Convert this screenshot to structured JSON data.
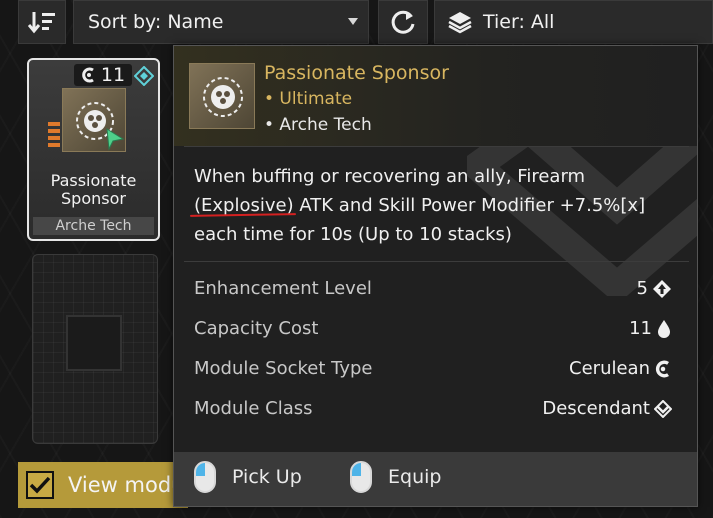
{
  "toolbar": {
    "sort_order_icon": "sort-descending-icon",
    "sort_label": "Sort by: Name",
    "refresh_icon": "refresh-icon",
    "tier_icon": "layers-icon",
    "tier_label": "Tier: All"
  },
  "module_card": {
    "capacity": "11",
    "capacity_icon": "cerulean-socket-icon",
    "name": "Passionate Sponsor",
    "brand": "Arche Tech",
    "tier_color": "#e07a2c"
  },
  "view_toggle": {
    "label": "View modu",
    "checked": true
  },
  "tooltip": {
    "title": "Passionate Sponsor",
    "tier": "• Ultimate",
    "brand": "• Arche Tech",
    "description_pre": "When buffing or recovering an ally, Firearm ",
    "description_highlight": "(Explosive)",
    "description_post": " ATK and Skill Power Modifier +7.5%[x] each time for 10s (Up to 10 stacks)",
    "stats": [
      {
        "label": "Enhancement Level",
        "value": "5",
        "icon": "enhancement-arrow-icon"
      },
      {
        "label": "Capacity Cost",
        "value": "11",
        "icon": "droplet-icon"
      },
      {
        "label": "Module Socket Type",
        "value": "Cerulean",
        "icon": "cerulean-socket-icon"
      },
      {
        "label": "Module Class",
        "value": "Descendant",
        "icon": "descendant-class-icon"
      }
    ],
    "footer": {
      "pickup_label": "Pick Up",
      "equip_label": "Equip"
    },
    "accent_color": "#d8b660"
  }
}
